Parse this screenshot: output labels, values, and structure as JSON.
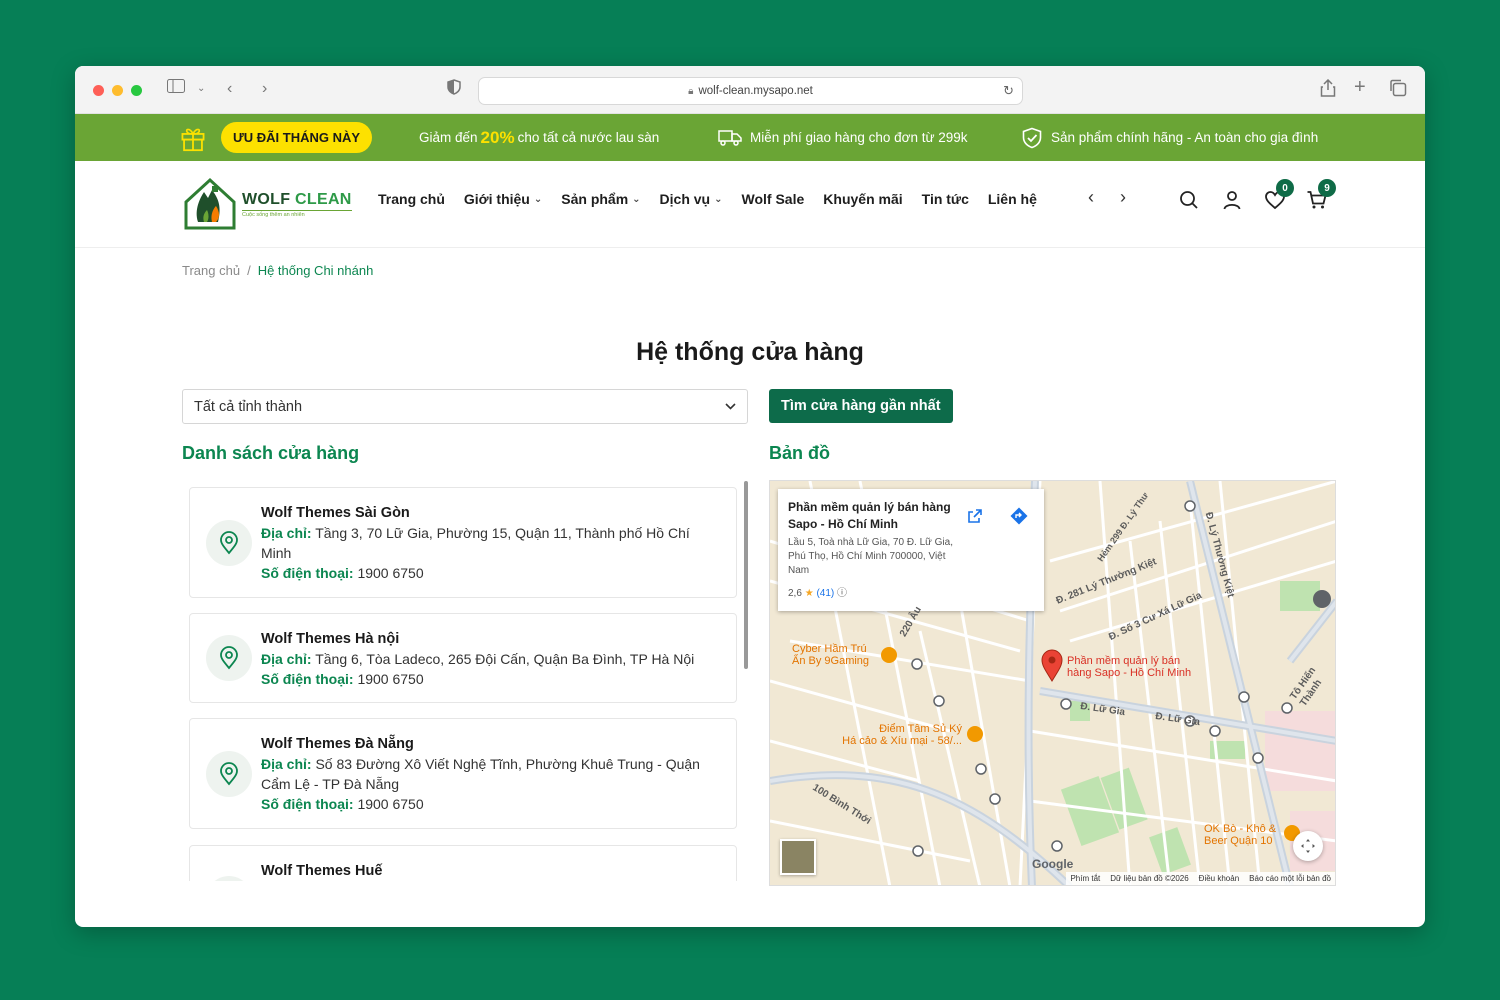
{
  "browser": {
    "url": "wolf-clean.mysapo.net"
  },
  "promo": {
    "pill": "ƯU ĐÃI THÁNG NÀY",
    "discount_prefix": "Giảm đến",
    "discount_value": "20%",
    "discount_suffix": "cho tất cả nước lau sàn",
    "shipping": "Miễn phí giao hàng cho đơn từ 299k",
    "genuine": "Sản phẩm chính hãng - An toàn cho gia đình"
  },
  "logo": {
    "name_a": "WOLF",
    "name_b": "CLEAN",
    "tagline": "Cuộc sống thêm an nhiên"
  },
  "nav": {
    "items": [
      {
        "label": "Trang chủ"
      },
      {
        "label": "Giới thiệu"
      },
      {
        "label": "Sản phẩm"
      },
      {
        "label": "Dịch vụ"
      },
      {
        "label": "Wolf Sale"
      },
      {
        "label": "Khuyến mãi"
      },
      {
        "label": "Tin tức"
      },
      {
        "label": "Liên hệ"
      }
    ]
  },
  "header": {
    "wishlist_count": "0",
    "cart_count": "9"
  },
  "breadcrumb": {
    "home": "Trang chủ",
    "separator": "/",
    "current": "Hệ thống Chi nhánh"
  },
  "page": {
    "title": "Hệ thống cửa hàng",
    "province_select": "Tất cả tỉnh thành",
    "find_button": "Tìm cửa hàng gần nhất",
    "list_title": "Danh sách cửa hàng",
    "map_title": "Bản đồ"
  },
  "stores": {
    "address_label": "Địa chỉ:",
    "phone_label": "Số điện thoại:",
    "items": [
      {
        "name": "Wolf Themes Sài Gòn",
        "address": "Tầng 3, 70 Lữ Gia, Phường 15, Quận 11, Thành phố Hồ Chí Minh",
        "phone": "1900 6750"
      },
      {
        "name": "Wolf Themes Hà nội",
        "address": "Tầng 6, Tòa Ladeco, 265 Đội Cấn, Quận Ba Đình, TP Hà Nội",
        "phone": "1900 6750"
      },
      {
        "name": "Wolf Themes Đà Nẵng",
        "address": "Số 83 Đường Xô Viết Nghệ Tĩnh, Phường Khuê Trung - Quận Cẩm Lệ - TP Đà Nẵng",
        "phone": "1900 6750"
      },
      {
        "name": "Wolf Themes Huế"
      }
    ]
  },
  "map": {
    "card_title": "Phần mềm quản lý bán hàng Sapo - Hồ Chí Minh",
    "card_address": "Lầu 5, Toà nhà Lữ Gia, 70 Đ. Lữ Gia, Phú Thọ, Hồ Chí Minh 700000, Việt Nam",
    "rating": "2,6",
    "reviews": "(41)",
    "pin_label_1": "Phần mềm quản lý bán",
    "pin_label_2": "hàng Sapo - Hồ Chí Minh",
    "poi_1a": "Cyber Hầm Trú",
    "poi_1b": "Ẩn By 9Gaming",
    "poi_2a": "Điểm Tâm Sủ Ký",
    "poi_2b": "Há cảo & Xíu mại - 58/...",
    "poi_3a": "OK Bò - Khô &",
    "poi_3b": "Beer Quận 10",
    "street_1": "Đ. 281 Lý Thường Kiệt",
    "street_2": "Đ. Lữ Gia",
    "street_3": "Đ. Lữ Gia",
    "street_4": "100 Bình Thới",
    "street_5": "Đ. Lý Thường Kiệt",
    "street_6": "Tô Hiến Thành",
    "street_7": "Đ. Số 3 Cư Xá Lữ Gia",
    "street_8": "Hẻm 299 Đ. Lý Thư",
    "street_9": "220 Âu",
    "google": "Google",
    "footer": {
      "shortcuts": "Phím tắt",
      "data": "Dữ liệu bản đồ ©2026",
      "terms": "Điều khoản",
      "report": "Báo cáo một lỗi bản đồ"
    }
  }
}
